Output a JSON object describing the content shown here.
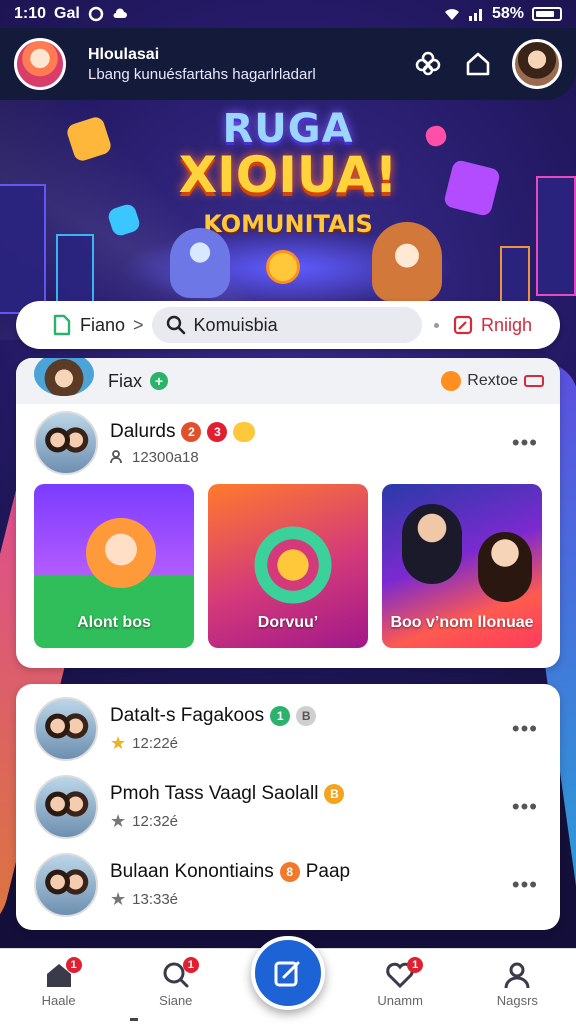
{
  "status_bar": {
    "time": "1:10",
    "carrier": "Gal",
    "right_text": "58%"
  },
  "header": {
    "title": "Hloulasai",
    "subtitle": "Lbang kunuésfartahs hagarlrladarl"
  },
  "hero": {
    "line1": "RUGA",
    "line2": "XIOIUA!",
    "line3": "KOMUNITAIS"
  },
  "filter_bar": {
    "item1": "Fiano",
    "separator": ">",
    "search_value": "Komuisbia",
    "right_label": "Rniigh"
  },
  "card1": {
    "header_title": "Fiax",
    "header_right": "Rextoe",
    "post": {
      "title": "Dalurds",
      "badge1": "2",
      "badge2": "3",
      "meta": "12300a18"
    },
    "tiles": [
      {
        "label": "Alont bos"
      },
      {
        "label": "Dorvuu’"
      },
      {
        "label": "Boo v’nom llonuae"
      }
    ]
  },
  "card2": {
    "posts": [
      {
        "title": "Datalt-s Fagakoos",
        "badge1": "1",
        "badge2": "B",
        "time": "12:22é"
      },
      {
        "title": "Pmoh Tass Vaagl Saolall",
        "badge1": "B",
        "time": "12:32é"
      },
      {
        "title": "Bulaan Konontiains",
        "badge1": "8",
        "extra": "Paap",
        "time": "13:33é"
      }
    ]
  },
  "bottom_nav": {
    "items": [
      {
        "label": "Haale",
        "badge": "1"
      },
      {
        "label": "Siane",
        "badge": "1"
      },
      {
        "label": "Unamm",
        "badge": "1"
      },
      {
        "label": "Nagsrs"
      }
    ]
  },
  "colors": {
    "accent_blue": "#1e63d6",
    "badge_red": "#e02030",
    "star_gold": "#f2b01e",
    "header_bg": "#141a3a"
  }
}
